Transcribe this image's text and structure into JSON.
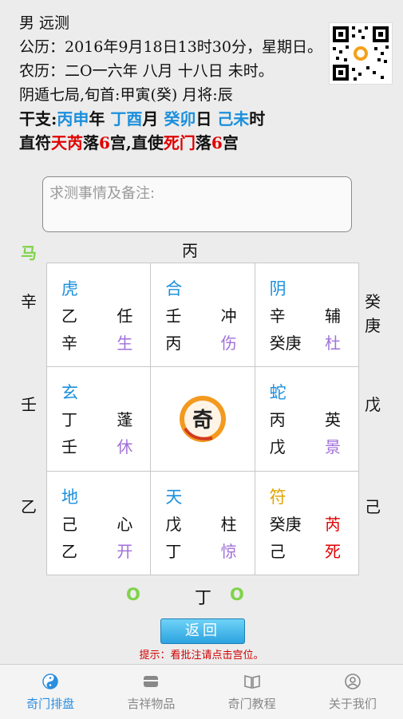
{
  "header": {
    "line1": "男 远测",
    "line2": "公历：2016年9月18日13时30分，星期日。",
    "line3": "农历：二O一六年 八月 十八日 未时。",
    "line4": "阴遁七局,旬首:甲寅(癸) 月将:辰",
    "ganzhi": {
      "label": "干支:",
      "year": "丙申",
      "year_suffix": "年 ",
      "month": "丁酉",
      "month_suffix": "月 ",
      "day": "癸卯",
      "day_suffix": "日 ",
      "hour": "己未",
      "hour_suffix": "时"
    },
    "zhifu": {
      "p1": "直符",
      "star": "天芮",
      "p2": "落",
      "palace1": "6",
      "p3": "宫,直使",
      "door": "死门",
      "p4": "落",
      "palace2": "6",
      "p5": "宫"
    }
  },
  "notes": {
    "placeholder": "求测事情及备注:"
  },
  "board": {
    "horse": "马",
    "top": "丙",
    "left": [
      "辛",
      "壬",
      "乙"
    ],
    "right": [
      "癸庚",
      "戊",
      "己"
    ],
    "bottom_markers": [
      "O",
      "O"
    ],
    "bottom_stem": "丁",
    "cells": [
      {
        "god": "虎",
        "tl": "乙",
        "tr": "任",
        "bl": "辛",
        "br": "生"
      },
      {
        "god": "合",
        "tl": "壬",
        "tr": "冲",
        "bl": "丙",
        "br": "伤"
      },
      {
        "god": "阴",
        "tl": "辛",
        "tr": "辅",
        "bl": "癸庚",
        "br": "杜"
      },
      {
        "god": "玄",
        "tl": "丁",
        "tr": "蓬",
        "bl": "壬",
        "br": "休"
      },
      {
        "god": "蛇",
        "tl": "丙",
        "tr": "英",
        "bl": "戊",
        "br": "景"
      },
      {
        "god": "地",
        "tl": "己",
        "tr": "心",
        "bl": "乙",
        "br": "开"
      },
      {
        "god": "天",
        "tl": "戊",
        "tr": "柱",
        "bl": "丁",
        "br": "惊"
      },
      {
        "god": "符",
        "tl": "癸庚",
        "tr": "芮",
        "bl": "己",
        "br": "死"
      }
    ],
    "center_logo": "奇"
  },
  "back_button": "返回",
  "hint": "提示：看批注请点击宫位。",
  "tabs": [
    {
      "label": "奇门排盘",
      "icon": "yin-yang-icon",
      "active": true
    },
    {
      "label": "吉祥物品",
      "icon": "box-icon",
      "active": false
    },
    {
      "label": "奇门教程",
      "icon": "book-icon",
      "active": false
    },
    {
      "label": "关于我们",
      "icon": "person-icon",
      "active": false
    }
  ],
  "colors": {
    "blue": "#1b8fdc",
    "red": "#e00000",
    "purple": "#a070d8",
    "green": "#7fd34a",
    "gold": "#e0a500",
    "tab_active": "#2a8ee0"
  }
}
